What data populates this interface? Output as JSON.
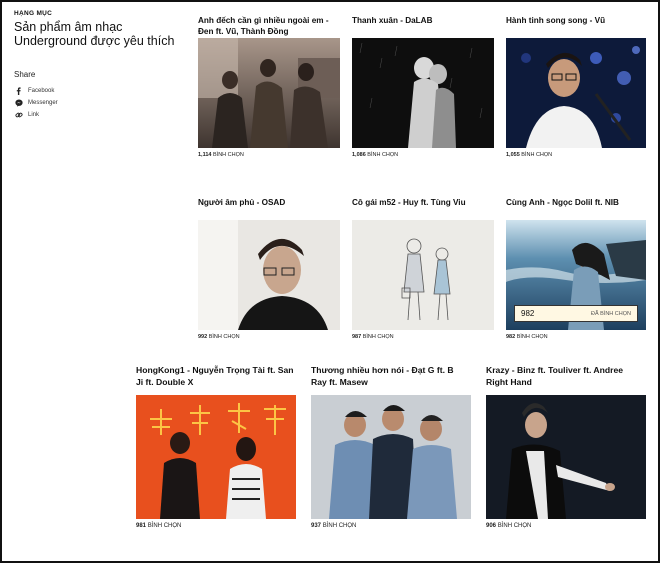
{
  "sidebar": {
    "category_label": "HẠNG MỤC",
    "category_title": "Sản phẩm âm nhạc Underground được yêu thích",
    "share_label": "Share",
    "share_items": [
      {
        "label": "Facebook",
        "icon": "facebook-icon"
      },
      {
        "label": "Messenger",
        "icon": "messenger-icon"
      },
      {
        "label": "Link",
        "icon": "link-icon"
      }
    ]
  },
  "vote_unit": "BÌNH CHỌN",
  "cards": [
    {
      "title": "Anh đếch cần gì nhiều ngoài em - Đen ft. Vũ, Thành Đồng",
      "votes": "1,114"
    },
    {
      "title": "Thanh xuân - DaLAB",
      "votes": "1,086"
    },
    {
      "title": "Hành tinh song song - Vũ",
      "votes": "1,055"
    },
    {
      "title": "Người âm phủ - OSAD",
      "votes": "992"
    },
    {
      "title": "Cô gái m52 - Huy ft. Tùng Viu",
      "votes": "987"
    },
    {
      "title": "Cùng Anh - Ngọc Dolil ft. NIB",
      "votes": "982"
    },
    {
      "title": "HongKong1 - Nguyễn Trọng Tài ft. San Ji ft. Double X",
      "votes": "981"
    },
    {
      "title": "Thương nhiều hơn nói - Đạt G ft. B Ray ft. Masew",
      "votes": "937"
    },
    {
      "title": "Krazy - Binz ft. Touliver ft. Andree Right Hand",
      "votes": "906"
    }
  ],
  "hover_vote": {
    "count": "982",
    "button": "ĐÃ BÌNH CHỌN"
  },
  "colors": {
    "accent_bar": "#fff8e3",
    "neon_orange": "#e8501e"
  }
}
